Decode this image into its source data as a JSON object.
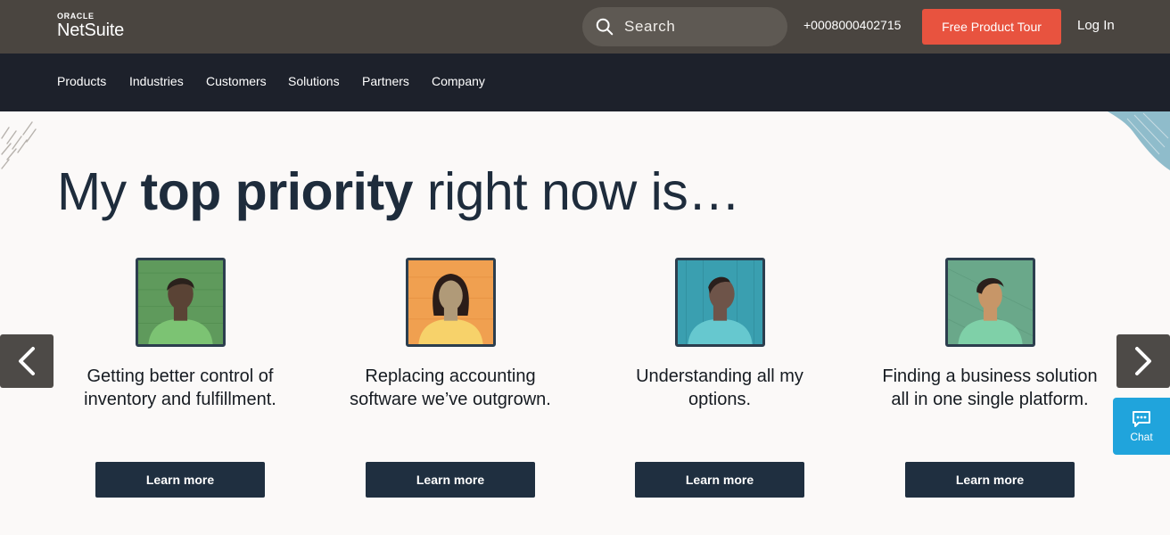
{
  "header": {
    "logo_top": "ORACLE",
    "logo_main": "NetSuite",
    "search_label": "Search",
    "phone": "+0008000402715",
    "tour_button": "Free Product Tour",
    "login": "Log In"
  },
  "nav": {
    "items": [
      "Products",
      "Industries",
      "Customers",
      "Solutions",
      "Partners",
      "Company"
    ]
  },
  "hero": {
    "headline_pre": "My ",
    "headline_bold": "top priority",
    "headline_post": " right now is…"
  },
  "cards": [
    {
      "text": "Getting better control of inventory and fulfillment.",
      "button": "Learn more",
      "bg_color": "#5f9a5c",
      "shirt_color": "#7cc373",
      "skin_color": "#5a4335"
    },
    {
      "text": "Replacing accounting software we’ve outgrown.",
      "button": "Learn more",
      "bg_color": "#f0a050",
      "shirt_color": "#f7d26a",
      "skin_color": "#b09a78"
    },
    {
      "text": "Understanding all my options.",
      "button": "Learn more",
      "bg_color": "#3a9fb0",
      "shirt_color": "#66c8cf",
      "skin_color": "#6e5449"
    },
    {
      "text": "Finding a business solution all in one single platform.",
      "button": "Learn more",
      "bg_color": "#6aa88a",
      "shirt_color": "#7fd0a8",
      "skin_color": "#c79668"
    }
  ],
  "chat": {
    "label": "Chat"
  },
  "colors": {
    "topbar": "#4a4540",
    "navbar": "#1d212b",
    "accent": "#e8533f",
    "button_dark": "#1f2f40",
    "chat": "#20a4dc"
  },
  "icons": {
    "search": "search-icon",
    "arrow_left": "chevron-left-icon",
    "arrow_right": "chevron-right-icon",
    "chat": "chat-bubble-icon"
  }
}
